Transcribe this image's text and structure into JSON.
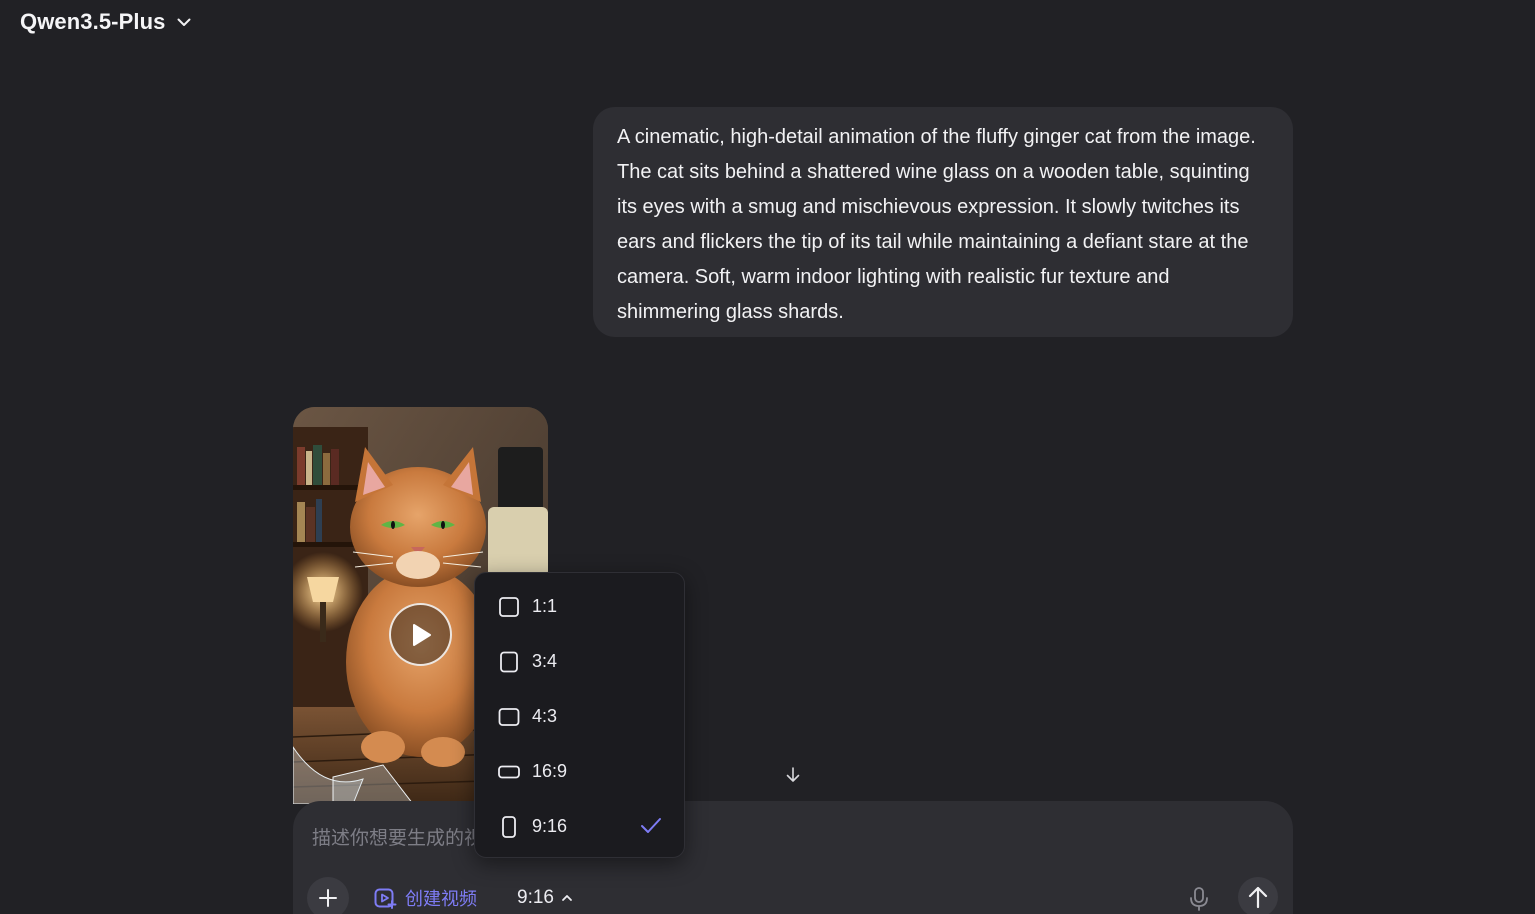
{
  "header": {
    "model_name": "Qwen3.5-Plus",
    "chevron_icon": "chevron-down-icon"
  },
  "conversation": {
    "user_message": "A cinematic, high-detail animation of the fluffy ginger cat from the image. The cat sits behind a shattered wine glass on a wooden table, squinting its eyes with a smug and mischievous expression. It slowly twitches its ears and flickers the tip of its tail while maintaining a defiant stare at the camera. Soft, warm indoor lighting with realistic fur texture and shimmering glass shards."
  },
  "video": {
    "play_icon": "play-icon"
  },
  "composer": {
    "placeholder": "描述你想要生成的视频",
    "mode_label": "创建视频",
    "selected_ratio": "9:16",
    "icons": [
      "plus-icon",
      "video-create-icon",
      "chevron-up-icon",
      "microphone-icon",
      "arrow-up-icon"
    ]
  },
  "ratio_menu": {
    "items": [
      {
        "label": "1:1",
        "shape": "square",
        "selected": false
      },
      {
        "label": "3:4",
        "shape": "portrait",
        "selected": false
      },
      {
        "label": "4:3",
        "shape": "landscape",
        "selected": false
      },
      {
        "label": "16:9",
        "shape": "wide",
        "selected": false
      },
      {
        "label": "9:16",
        "shape": "tall",
        "selected": true
      }
    ]
  },
  "colors": {
    "background": "#212125",
    "bubble": "#2e2e33",
    "accent": "#7e7cf5",
    "menu": "#1b1b1f"
  }
}
